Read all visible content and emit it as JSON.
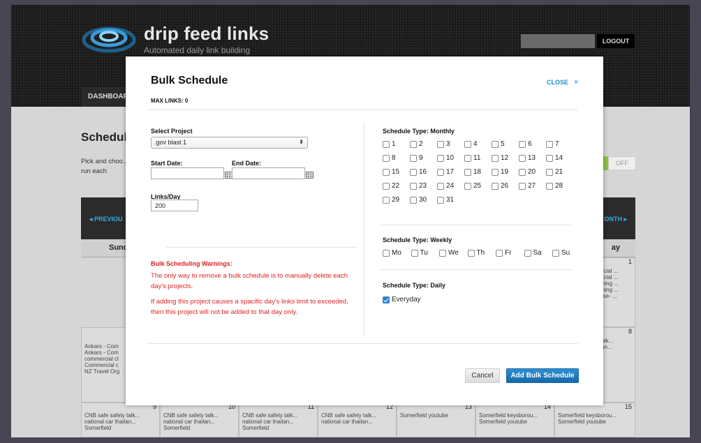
{
  "header": {
    "brand_title": "drip feed links",
    "brand_subtitle": "Automated daily link building",
    "logout_label": "LOGOUT"
  },
  "nav": {
    "dashboard_label": "DASHBOARD"
  },
  "page": {
    "title": "Schedule",
    "description": "Pick and choo... schedule to a... it will run each",
    "toggle_off_label": "OFF"
  },
  "calendar": {
    "prev_label": "◂ PREVIOU",
    "next_label": "ONTH ▸",
    "day_sunday": "Sund",
    "day_saturday": "ay",
    "sat_wk1_num": "1",
    "sat_wk1_events": [
      "nercial ...",
      "nercial ...",
      "eaning ...",
      "eaning ...",
      "anise- ..."
    ],
    "sun_wk2_events": [
      "Ankars - Com",
      "Ankars - Com",
      "commercial cl",
      "Commercial c",
      "NZ Travel Org"
    ],
    "sat_wk2_num": "8",
    "sat_wk2_events": [
      "y talk...",
      "ailan..."
    ],
    "row3": [
      {
        "num": "9",
        "events": [
          "CNB safe safety talk...",
          "national car thailan...",
          "Somerfield"
        ]
      },
      {
        "num": "10",
        "events": [
          "CNB safe safety talk...",
          "national car thailan...",
          "Somerfield"
        ]
      },
      {
        "num": "11",
        "events": [
          "CNB safe safety talk...",
          "national car thailan...",
          "Somerfield"
        ]
      },
      {
        "num": "12",
        "events": [
          "CNB safe safety talk...",
          "national car thailan..."
        ]
      },
      {
        "num": "13",
        "events": [
          "Somerfield youtube"
        ]
      },
      {
        "num": "14",
        "events": [
          "Somerfield keysborou...",
          "Somerfield youtube"
        ]
      },
      {
        "num": "15",
        "events": [
          "Somerfield keysborou...",
          "Somerfield youtube"
        ]
      }
    ]
  },
  "modal": {
    "title": "Bulk Schedule",
    "close_label": "CLOSE",
    "close_x": "×",
    "max_links": "MAX LINKS: 0",
    "select_project_label": "Select Project",
    "project_value": ".gov blast 1",
    "start_date_label": "Start Date:",
    "end_date_label": "End Date:",
    "start_date_value": "",
    "end_date_value": "",
    "links_day_label": "Links/Day",
    "links_day_value": "200",
    "warnings_title": "Bulk Scheduling Warnings:",
    "warning_1": "The only way to remove a bulk schedule is to manually delete each day's projects.",
    "warning_2": "If adding this project causes a spacific day's links limit to exceeded, then this project will not be added to that day only.",
    "monthly_label": "Schedule Type: Monthly",
    "monthly_days": [
      "1",
      "2",
      "3",
      "4",
      "5",
      "6",
      "7",
      "8",
      "9",
      "10",
      "11",
      "12",
      "13",
      "14",
      "15",
      "16",
      "17",
      "18",
      "19",
      "20",
      "21",
      "22",
      "23",
      "24",
      "25",
      "26",
      "27",
      "28",
      "29",
      "30",
      "31"
    ],
    "weekly_label": "Schedule Type: Weekly",
    "weekly_days": [
      "Mo",
      "Tu",
      "We",
      "Th",
      "Fr",
      "Sa",
      "Su"
    ],
    "daily_label": "Schedule Type: Daily",
    "daily_option": "Everyday",
    "daily_checked": true,
    "cancel_label": "Cancel",
    "add_label": "Add Bulk Schedule"
  },
  "colors": {
    "accent_blue": "#1a8fd1",
    "warning_red": "#e02020",
    "toggle_green": "#8cc63f"
  }
}
